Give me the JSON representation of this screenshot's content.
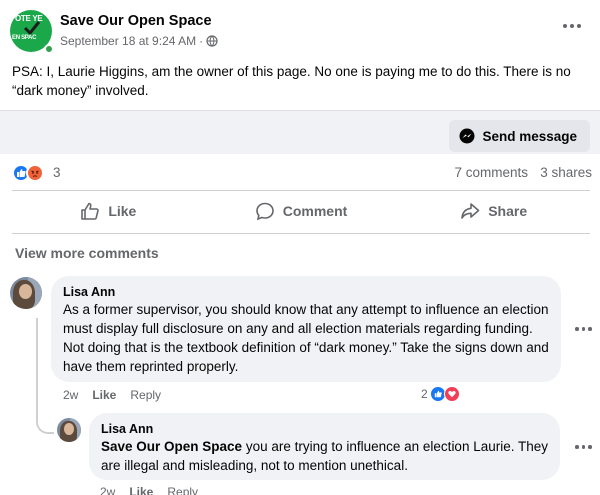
{
  "post": {
    "page_name": "Save Our Open Space",
    "timestamp": "September 18 at 9:24 AM",
    "separator": "·",
    "logo_text_top": "OTE YE",
    "logo_text_bottom": "EN SPAC",
    "text": "PSA:  I, Laurie Higgins, am the owner of this page.  No one is paying me to do this.  There is no “dark money” involved.",
    "send_message_label": "Send message"
  },
  "stats": {
    "reaction_count": "3",
    "comments": "7 comments",
    "shares": "3 shares"
  },
  "actions": {
    "like": "Like",
    "comment": "Comment",
    "share": "Share"
  },
  "comments_section": {
    "view_more": "View more comments",
    "comments": [
      {
        "author": "Lisa Ann",
        "text": "As a former supervisor, you should know that any attempt to influence an election must display full disclosure on any and all election materials regarding funding. Not doing that is the textbook definition of “dark money.” Take the signs down and have them reprinted properly.",
        "time": "2w",
        "like_label": "Like",
        "reply_label": "Reply",
        "reaction_count": "2"
      }
    ],
    "replies": [
      {
        "author": "Lisa Ann",
        "mention": "Save Our Open Space",
        "text": " you are trying to influence an election Laurie. They are illegal and misleading, not to mention unethical.",
        "time": "2w",
        "like_label": "Like",
        "reply_label": "Reply"
      }
    ]
  },
  "colors": {
    "facebook_blue": "#1877f2",
    "secondary_text": "#65676b",
    "bubble_bg": "#f0f2f5",
    "logo_green": "#1aa84a"
  }
}
